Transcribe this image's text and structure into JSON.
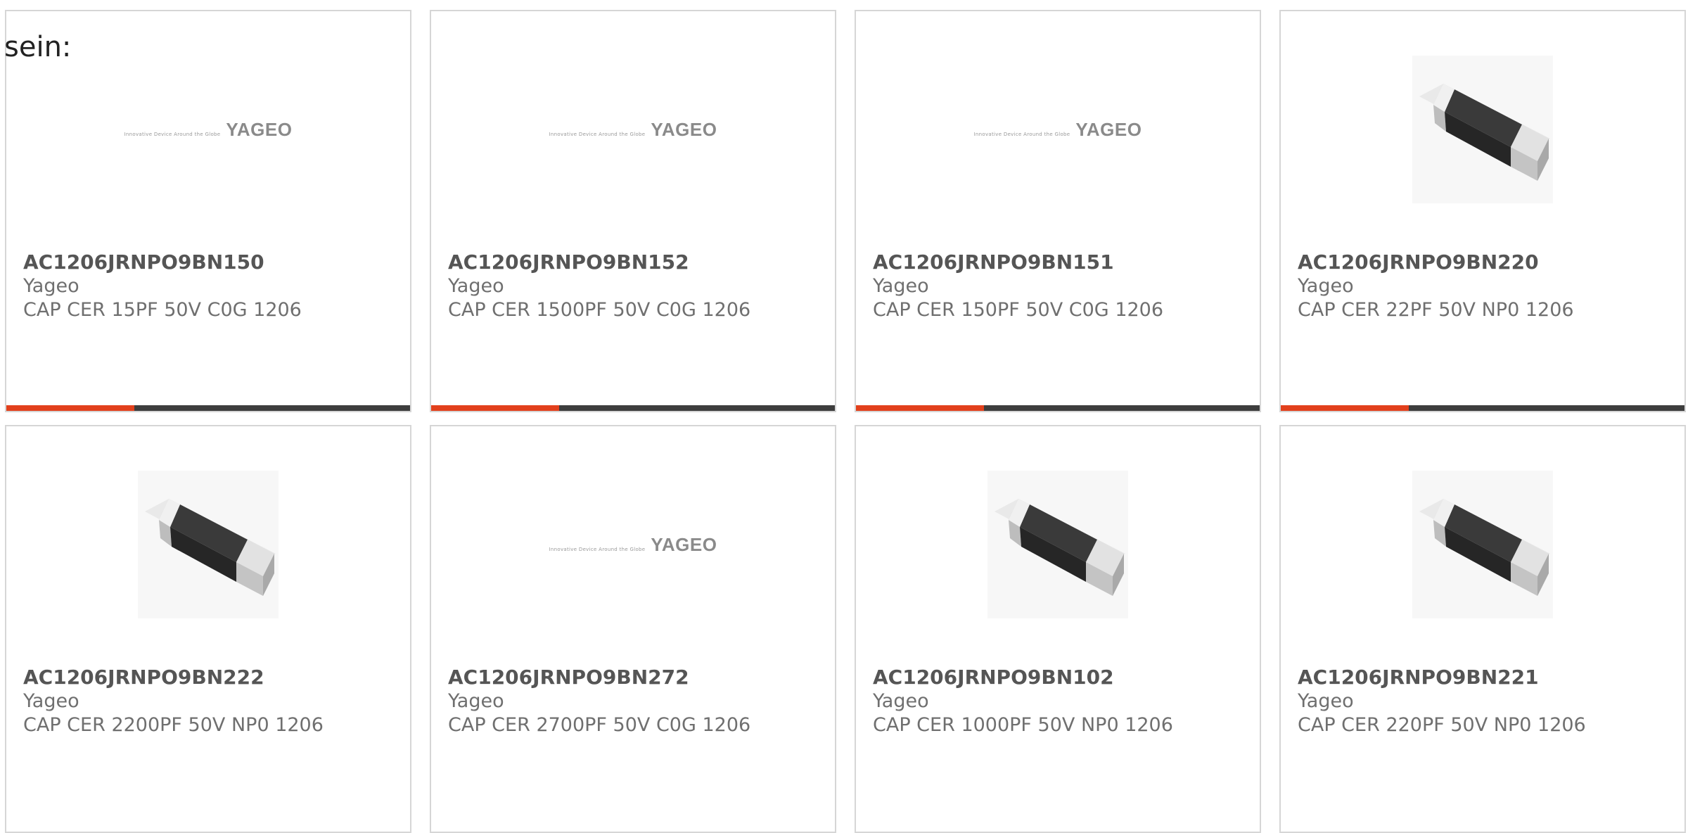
{
  "intro_text": "sein:",
  "logo": {
    "tagline": "Innovative Device Around the Globe",
    "wordmark": "YAGEO"
  },
  "colors": {
    "accent": "#e2401c",
    "bar_dark": "#3d3d3d",
    "card_border": "#d6d6d6",
    "text": "#6f6f6f"
  },
  "products": [
    {
      "part_number": "AC1206JRNPO9BN150",
      "manufacturer": "Yageo",
      "description": "CAP CER 15PF 50V C0G 1206",
      "image": "yageo-logo"
    },
    {
      "part_number": "AC1206JRNPO9BN152",
      "manufacturer": "Yageo",
      "description": "CAP CER 1500PF 50V C0G 1206",
      "image": "yageo-logo"
    },
    {
      "part_number": "AC1206JRNPO9BN151",
      "manufacturer": "Yageo",
      "description": "CAP CER 150PF 50V C0G 1206",
      "image": "yageo-logo"
    },
    {
      "part_number": "AC1206JRNPO9BN220",
      "manufacturer": "Yageo",
      "description": "CAP CER 22PF 50V NP0 1206",
      "image": "chip-capacitor"
    },
    {
      "part_number": "AC1206JRNPO9BN222",
      "manufacturer": "Yageo",
      "description": "CAP CER 2200PF 50V NP0 1206",
      "image": "chip-capacitor"
    },
    {
      "part_number": "AC1206JRNPO9BN272",
      "manufacturer": "Yageo",
      "description": "CAP CER 2700PF 50V C0G 1206",
      "image": "yageo-logo"
    },
    {
      "part_number": "AC1206JRNPO9BN102",
      "manufacturer": "Yageo",
      "description": "CAP CER 1000PF 50V NP0 1206",
      "image": "chip-capacitor"
    },
    {
      "part_number": "AC1206JRNPO9BN221",
      "manufacturer": "Yageo",
      "description": "CAP CER 220PF 50V NP0 1206",
      "image": "chip-capacitor"
    }
  ]
}
